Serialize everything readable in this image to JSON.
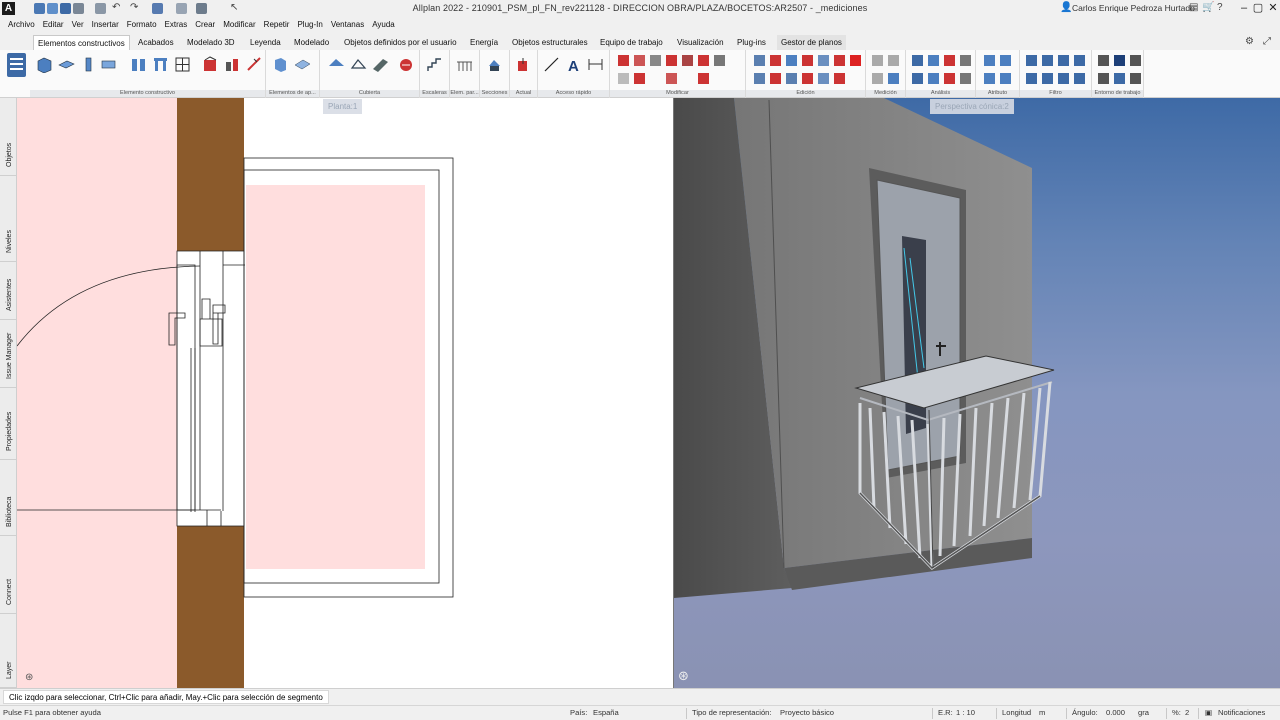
{
  "window": {
    "title": "Allplan 2022 - 210901_PSM_pl_FN_rev221128 - DIRECCION OBRA/PLAZA/BOCETOS:AR2507 - _mediciones",
    "user": "Carlos Enrique Pedroza Hurtado",
    "logo": "A"
  },
  "menu": [
    "Archivo",
    "Editar",
    "Ver",
    "Insertar",
    "Formato",
    "Extras",
    "Crear",
    "Modificar",
    "Repetir",
    "Plug-In",
    "Ventanas",
    "Ayuda"
  ],
  "ribbon_tabs": [
    "Elementos constructivos",
    "Acabados",
    "Modelado 3D",
    "Leyenda",
    "Modelado",
    "Objetos definidos por el usuario",
    "Energía",
    "Objetos estructurales",
    "Equipo de trabajo",
    "Visualización",
    "Plug-ins",
    "Gestor de planos"
  ],
  "ribbon_groups": [
    "Elemento constructivo",
    "Elementos de ap...",
    "Cubierta",
    "Escaleras",
    "Elem. par...",
    "Secciones",
    "Actual",
    "Acceso rápido",
    "Modificar",
    "Edición",
    "Medición",
    "Análisis",
    "Atributo",
    "Filtro",
    "Entorno de trabajo"
  ],
  "side_tabs": [
    "Objetos",
    "Niveles",
    "Asistentes",
    "Issue Manager",
    "Propiedades",
    "Biblioteca",
    "Connect",
    "Layer"
  ],
  "viewports": {
    "plan_label": "Planta:1",
    "persp_label": "Perspectiva cónica:2"
  },
  "prompt": "Clic izqdo para seleccionar, Ctrl+Clic para añadir, May.+Clic para selección de segmento",
  "status": {
    "help": "Pulse F1 para obtener ayuda",
    "country_label": "País:",
    "country": "España",
    "repr_label": "Tipo de representación:",
    "repr": "Proyecto básico",
    "scale_label": "E.R:",
    "scale": "1 : 10",
    "length_label": "Longitud",
    "length_unit": "m",
    "angle_label": "Ángulo:",
    "angle": "0.000",
    "angle_unit": "gra",
    "percent_label": "%:",
    "percent": "2",
    "notifications": "Notificaciones"
  },
  "colors": {
    "accent": "#2b5797",
    "wall_fill": "#ffdede",
    "wood": "#8b5a2b",
    "sky_top": "#3e6aa6"
  }
}
